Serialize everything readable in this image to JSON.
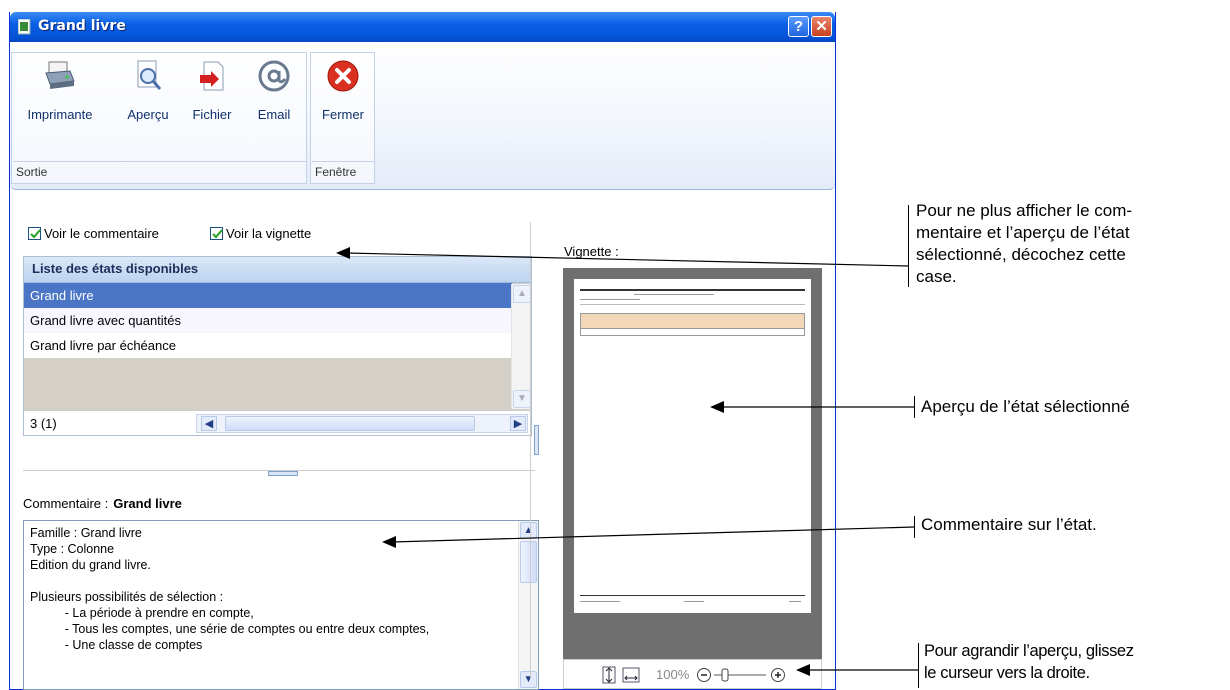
{
  "window": {
    "title": "Grand livre",
    "help_button": "?",
    "close_button": "✕"
  },
  "ribbon": {
    "groups": [
      {
        "label": "Sortie",
        "buttons": [
          {
            "label": "Imprimante",
            "icon": "printer-icon"
          },
          {
            "label": "Aperçu",
            "icon": "preview-icon"
          },
          {
            "label": "Fichier",
            "icon": "file-export-icon"
          },
          {
            "label": "Email",
            "icon": "email-at-icon"
          }
        ]
      },
      {
        "label": "Fenêtre",
        "buttons": [
          {
            "label": "Fermer",
            "icon": "close-circle-icon"
          }
        ]
      }
    ]
  },
  "options": {
    "show_comment": {
      "label": "Voir le commentaire",
      "checked": true
    },
    "show_thumbnail": {
      "label": "Voir la vignette",
      "checked": true
    }
  },
  "reports_list": {
    "header": "Liste des états disponibles",
    "items": [
      "Grand livre",
      "Grand livre avec quantités",
      "Grand livre par échéance"
    ],
    "selected_index": 0,
    "count": "3 (1)"
  },
  "comment": {
    "label": "Commentaire :",
    "report_name": "Grand livre",
    "text": "Famille : Grand livre\nType : Colonne\nEdition du grand livre.\n\nPlusieurs possibilités de sélection :\n          - La période à prendre en compte,\n          - Tous les comptes, une série de comptes ou entre deux comptes,\n          - Une classe de comptes"
  },
  "thumbnail": {
    "label": "Vignette :",
    "zoom": "100%"
  },
  "callouts": {
    "uncheck_hint": "Pour ne plus afficher le com-\nmentaire et l’aperçu de l’état\nsélectionné, décochez cette\ncase.",
    "preview_hint": "Aperçu de l’état sélectionné",
    "comment_hint": "Commentaire sur l’état.",
    "zoom_hint": "Pour agrandir l’aperçu, glissez\nle curseur vers la droite."
  },
  "colors": {
    "titlebar": "#0553d6",
    "selection": "#4b76c6",
    "list_header": "#bcd3ef",
    "thumbnail_background": "#6f6f6f",
    "close_icon": "#d9301f"
  }
}
